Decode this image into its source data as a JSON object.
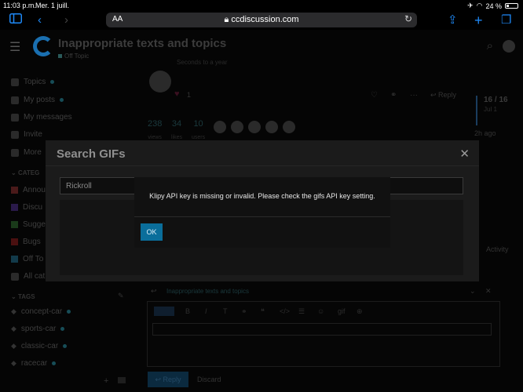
{
  "status_bar": {
    "time": "11:03 p.m.",
    "date": "Mer. 1 juill.",
    "battery": "24 %",
    "battery_level": 0.24
  },
  "browser": {
    "text_size": "AA",
    "url": "ccdiscussion.com"
  },
  "header": {
    "title": "Inappropriate texts and topics",
    "category": "Off Topic"
  },
  "sidebar": {
    "nav": [
      {
        "label": "Topics"
      },
      {
        "label": "My posts"
      },
      {
        "label": "My messages"
      },
      {
        "label": "Invite"
      },
      {
        "label": "More"
      }
    ],
    "categories_heading": "CATEG",
    "categories": [
      {
        "label": "Annou",
        "color": "#4a1a1a"
      },
      {
        "label": "Discu",
        "color": "#2a1a4a"
      },
      {
        "label": "Sugge",
        "color": "#1a3a1a"
      },
      {
        "label": "Bugs",
        "color": "#4a1010"
      },
      {
        "label": "Off To",
        "color": "#123a4a"
      },
      {
        "label": "All cat"
      }
    ],
    "tags_heading": "TAGS",
    "tags": [
      {
        "label": "concept-car"
      },
      {
        "label": "sports-car"
      },
      {
        "label": "classic-car"
      },
      {
        "label": "racecar"
      }
    ]
  },
  "post": {
    "faded_text": "Seconds to a year",
    "likes": "1",
    "reply_label": "Reply",
    "stats": [
      {
        "value": "238",
        "label": "views"
      },
      {
        "value": "34",
        "label": "likes"
      },
      {
        "value": "10",
        "label": "users"
      }
    ],
    "timeline": {
      "position": "16 / 16",
      "date": "Jul 1"
    },
    "last_activity": "2h ago",
    "activity_label": "Activity",
    "reply_to": "Inappropriate texts and topics"
  },
  "composer": {
    "reply_button": "Reply",
    "discard": "Discard"
  },
  "gif_modal": {
    "title": "Search GIFs",
    "search_value": "Rickroll"
  },
  "alert": {
    "message": "Klipy API key is missing or invalid. Please check the gifs API key setting.",
    "ok_label": "OK"
  }
}
